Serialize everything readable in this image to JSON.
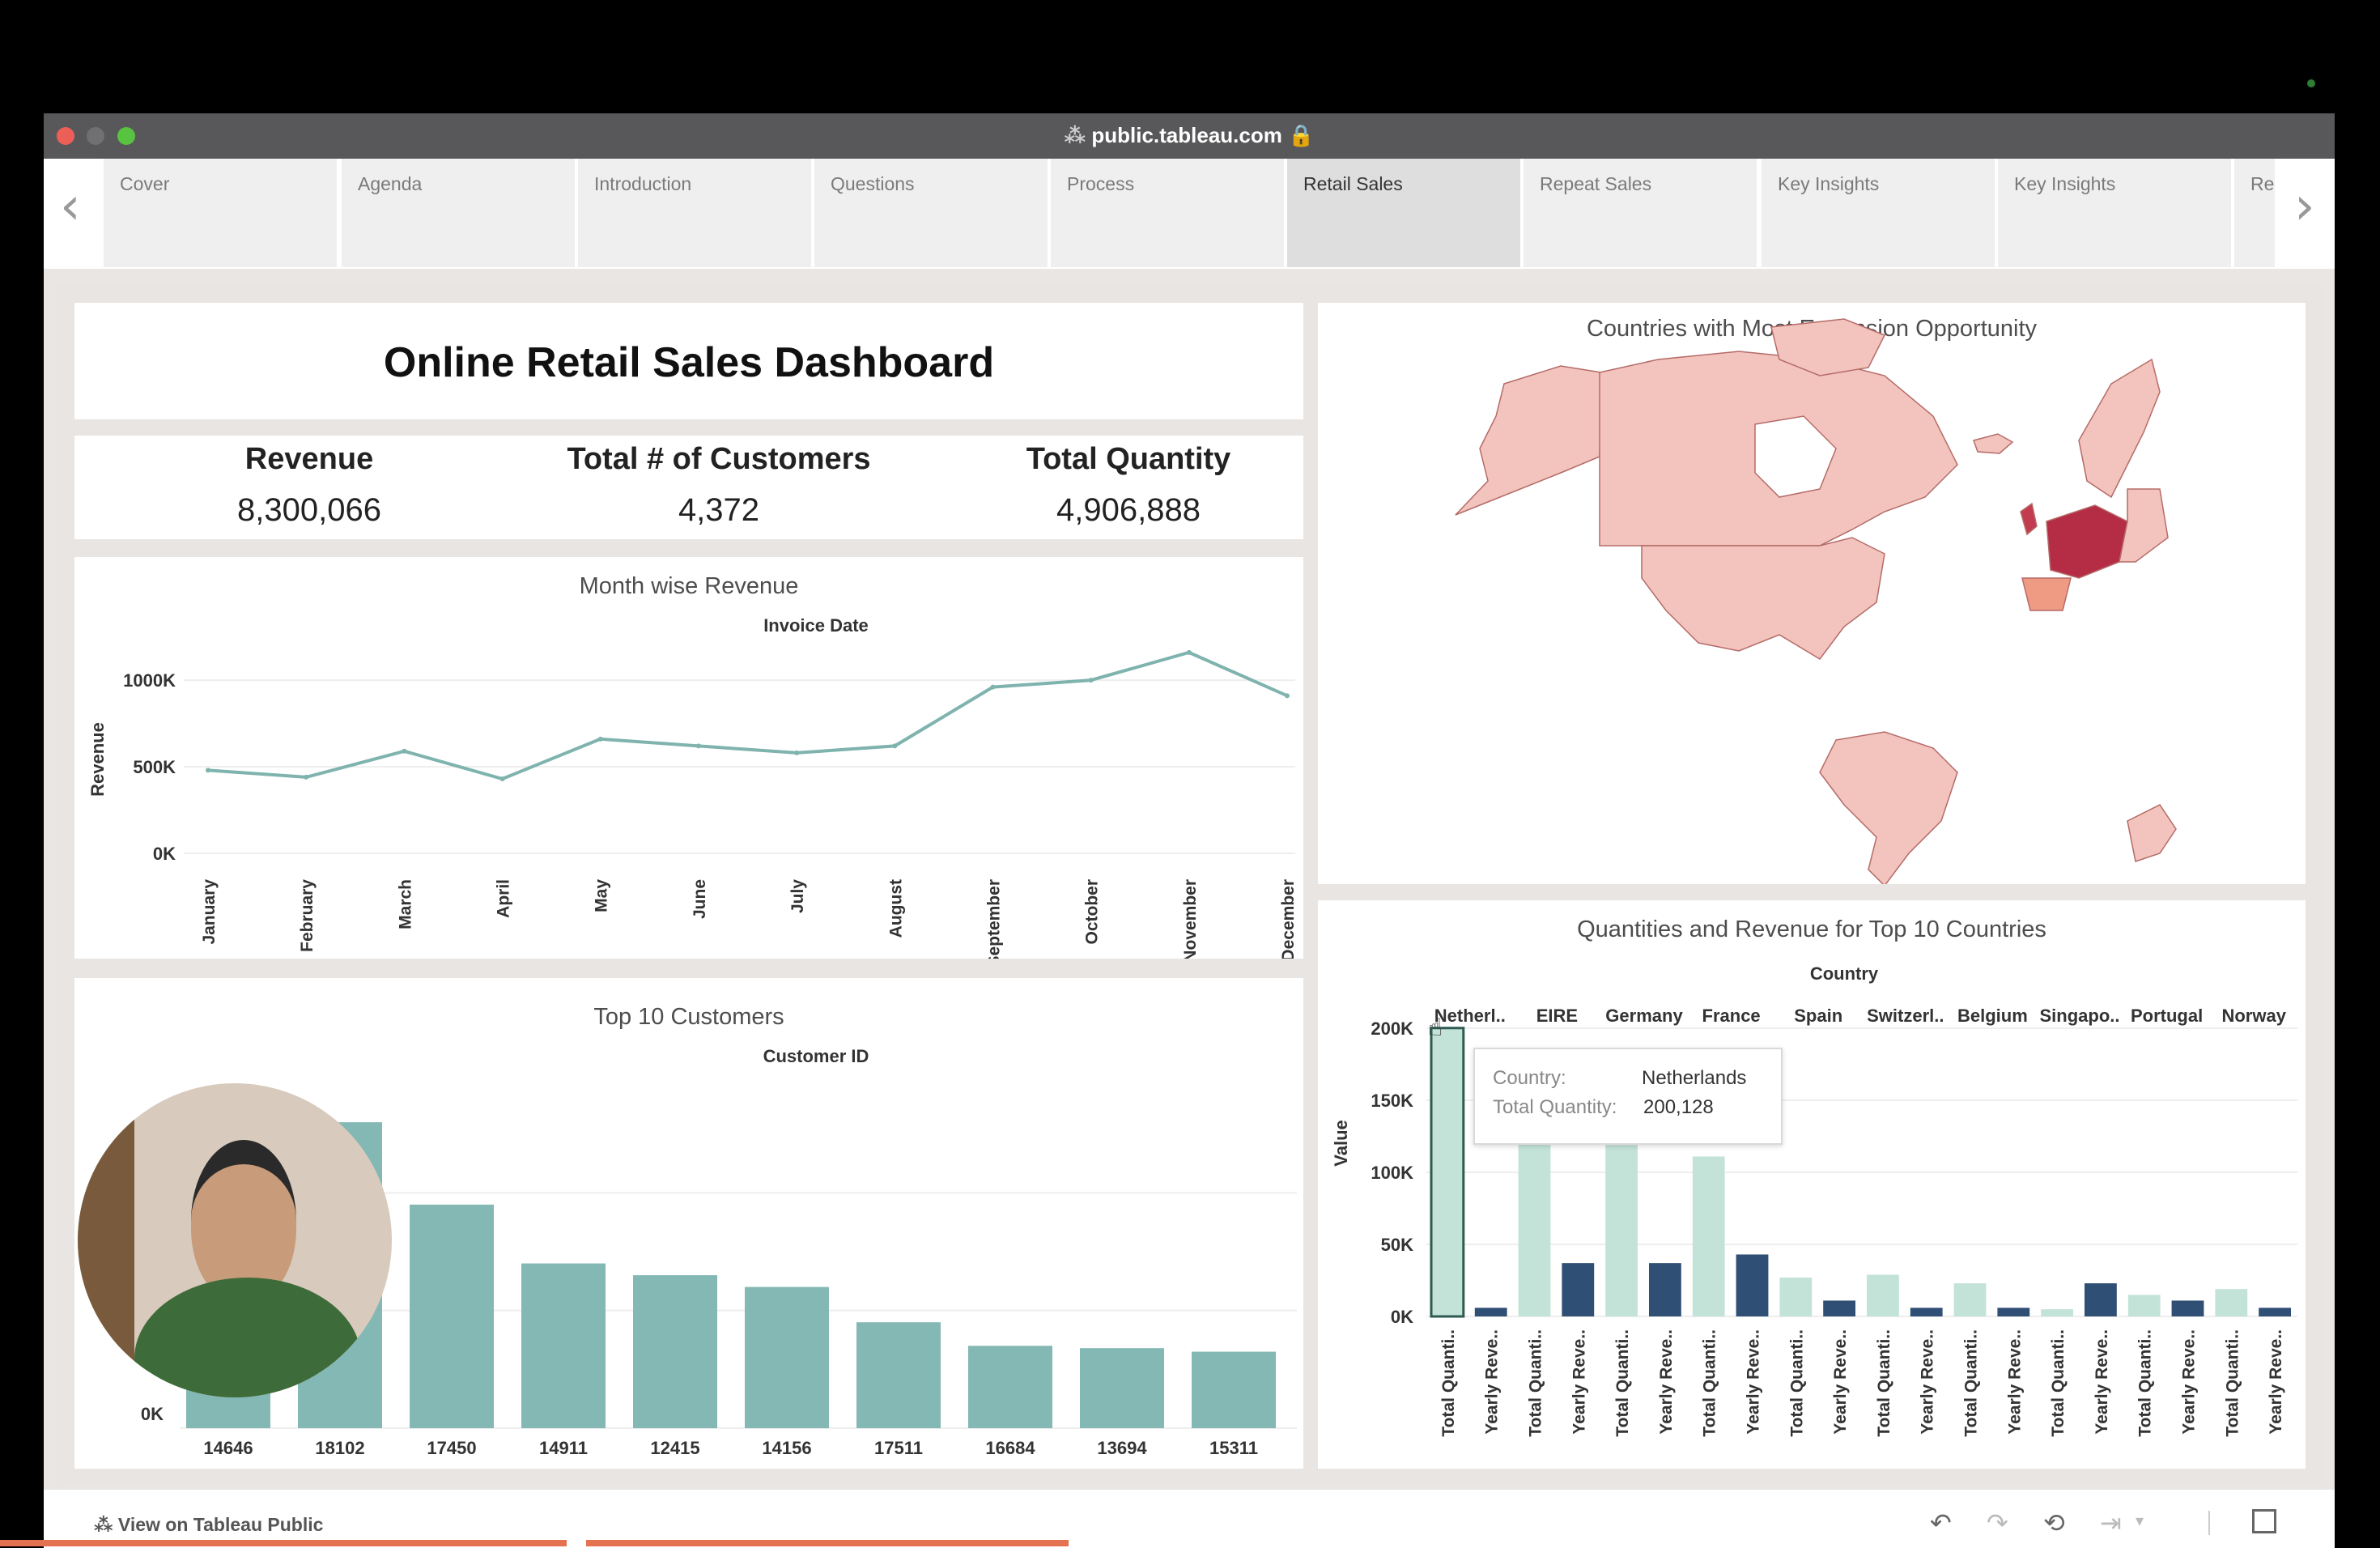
{
  "browser": {
    "url": "public.tableau.com"
  },
  "story_tabs": [
    {
      "label": "Cover"
    },
    {
      "label": "Agenda"
    },
    {
      "label": "Introduction"
    },
    {
      "label": "Questions"
    },
    {
      "label": "Process"
    },
    {
      "label": "Retail Sales",
      "active": true
    },
    {
      "label": "Repeat Sales"
    },
    {
      "label": "Key Insights"
    },
    {
      "label": "Key Insights"
    },
    {
      "label": "Re"
    }
  ],
  "dashboard": {
    "title": "Online Retail Sales Dashboard",
    "kpis": [
      {
        "label": "Revenue",
        "value": "8,300,066"
      },
      {
        "label": "Total # of Customers",
        "value": "4,372"
      },
      {
        "label": "Total Quantity",
        "value": "4,906,888"
      }
    ]
  },
  "month_chart": {
    "title": "Month wise Revenue",
    "subtitle": "Invoice Date",
    "ylabel": "Revenue",
    "yticks": [
      "1000K",
      "500K",
      "0K"
    ]
  },
  "customers_chart": {
    "title": "Top 10 Customers",
    "subtitle": "Customer ID",
    "ytick": "0K"
  },
  "map": {
    "title": "Countries with Most Expansion Opportunity"
  },
  "country_chart": {
    "title": "Quantities and Revenue for Top 10 Countries",
    "subtitle": "Country",
    "ylabel": "Value",
    "yticks": [
      "200K",
      "150K",
      "100K",
      "50K",
      "0K"
    ],
    "measure_labels": [
      "Total Quanti..",
      "Yearly Reve.."
    ],
    "tooltip": {
      "country_label": "Country:",
      "country_value": "Netherlands",
      "qty_label": "Total Quantity:",
      "qty_value": "200,128"
    }
  },
  "footer": {
    "link": "View on Tableau Public"
  },
  "colors": {
    "teal": "#84b8b4",
    "light_teal": "#c3e3d9",
    "navy": "#2f4f75",
    "line": "#7fb3ae"
  },
  "chart_data": [
    {
      "type": "line",
      "title": "Month wise Revenue",
      "xlabel": "Invoice Date",
      "ylabel": "Revenue",
      "categories": [
        "January",
        "February",
        "March",
        "April",
        "May",
        "June",
        "July",
        "August",
        "September",
        "October",
        "November",
        "December"
      ],
      "values": [
        480000,
        440000,
        590000,
        430000,
        660000,
        620000,
        580000,
        620000,
        960000,
        1000000,
        1160000,
        910000
      ],
      "ylim": [
        0,
        1150000
      ]
    },
    {
      "type": "bar",
      "title": "Top 10 Customers",
      "xlabel": "Customer ID",
      "categories": [
        "14646",
        "18102",
        "17450",
        "14911",
        "12415",
        "14156",
        "17511",
        "16684",
        "13694",
        "15311"
      ],
      "values": [
        280000,
        260000,
        190000,
        140000,
        130000,
        120000,
        90000,
        70000,
        68000,
        65000
      ]
    },
    {
      "type": "bar",
      "title": "Quantities and Revenue for Top 10 Countries",
      "xlabel": "Country",
      "ylabel": "Value",
      "categories": [
        "Netherl..",
        "EIRE",
        "Germany",
        "France",
        "Spain",
        "Switzerl..",
        "Belgium",
        "Singapo..",
        "Portugal",
        "Norway"
      ],
      "series": [
        {
          "name": "Total Quanti..",
          "values": [
            200128,
            147000,
            119000,
            111000,
            27000,
            29000,
            23000,
            5000,
            15000,
            19000
          ]
        },
        {
          "name": "Yearly Reve..",
          "values": [
            6000,
            37000,
            37000,
            43000,
            11000,
            6000,
            6000,
            23000,
            11000,
            6000
          ]
        }
      ],
      "ylim": [
        0,
        200000
      ]
    }
  ]
}
